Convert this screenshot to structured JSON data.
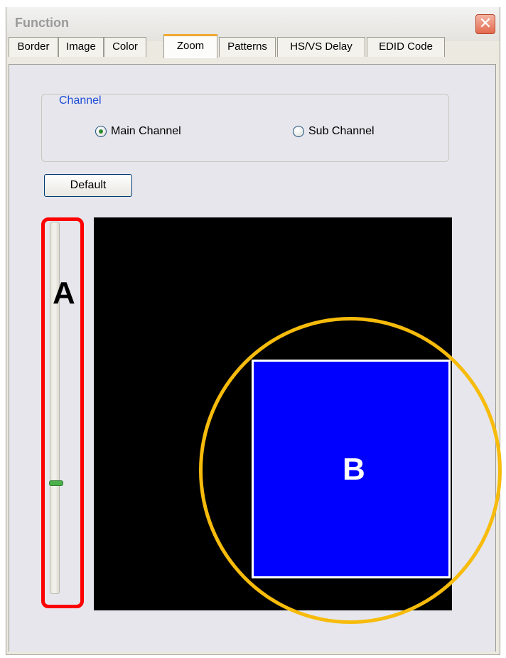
{
  "window": {
    "title": "Function",
    "close_symbol": "✕"
  },
  "tabs": [
    {
      "label": "Border",
      "active": false
    },
    {
      "label": "Image",
      "active": false
    },
    {
      "label": "Color",
      "active": false
    },
    {
      "label": "Zoom",
      "active": true
    },
    {
      "label": "Patterns",
      "active": false
    },
    {
      "label": "HS/VS Delay",
      "active": false
    },
    {
      "label": "EDID Code",
      "active": false
    }
  ],
  "channel": {
    "legend": "Channel",
    "options": [
      {
        "label": "Main Channel",
        "checked": true
      },
      {
        "label": "Sub Channel",
        "checked": false
      }
    ]
  },
  "default_button": {
    "label": "Default"
  },
  "zoom_slider": {
    "level_from_bottom": 0.3
  },
  "annotations": {
    "a_label": "A",
    "b_label": "B",
    "a_color": "#ff0000",
    "b_color": "#f7bb0b"
  },
  "preview": {
    "background": "#000000",
    "zoom_area_color": "#0000ff"
  }
}
